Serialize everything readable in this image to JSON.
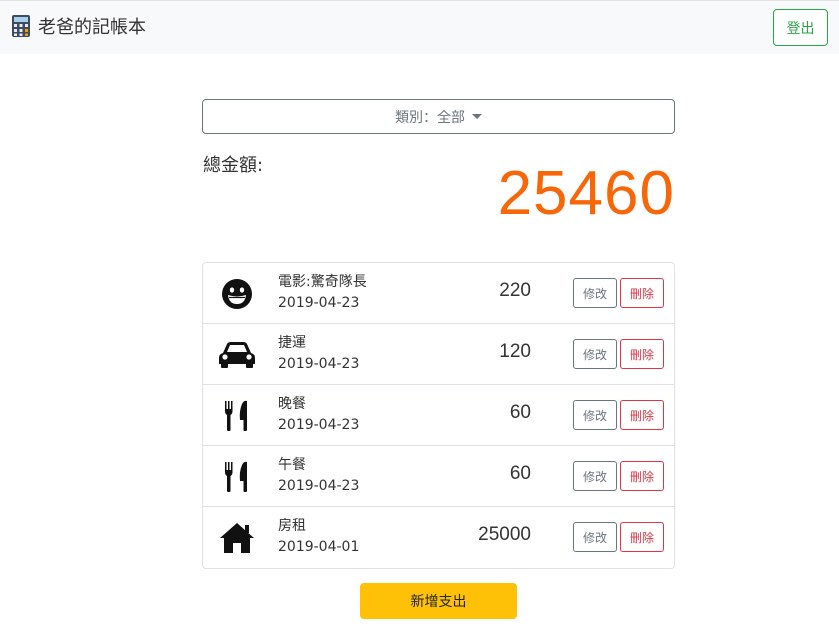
{
  "navbar": {
    "brand_icon": "abacus-icon",
    "brand_title": "老爸的記帳本",
    "logout_label": "登出"
  },
  "filter": {
    "category_label": "類別：全部"
  },
  "summary": {
    "total_label": "總金額:",
    "total_amount": "25460",
    "accent_color": "#f76707"
  },
  "records": [
    {
      "icon": "grin-face-icon",
      "name": "電影:驚奇隊長",
      "date": "2019-04-23",
      "amount": "220",
      "edit_label": "修改",
      "delete_label": "刪除"
    },
    {
      "icon": "car-icon",
      "name": "捷運",
      "date": "2019-04-23",
      "amount": "120",
      "edit_label": "修改",
      "delete_label": "刪除"
    },
    {
      "icon": "utensils-icon",
      "name": "晚餐",
      "date": "2019-04-23",
      "amount": "60",
      "edit_label": "修改",
      "delete_label": "刪除"
    },
    {
      "icon": "utensils-icon",
      "name": "午餐",
      "date": "2019-04-23",
      "amount": "60",
      "edit_label": "修改",
      "delete_label": "刪除"
    },
    {
      "icon": "home-icon",
      "name": "房租",
      "date": "2019-04-01",
      "amount": "25000",
      "edit_label": "修改",
      "delete_label": "刪除"
    }
  ],
  "actions": {
    "add_label": "新增支出"
  }
}
